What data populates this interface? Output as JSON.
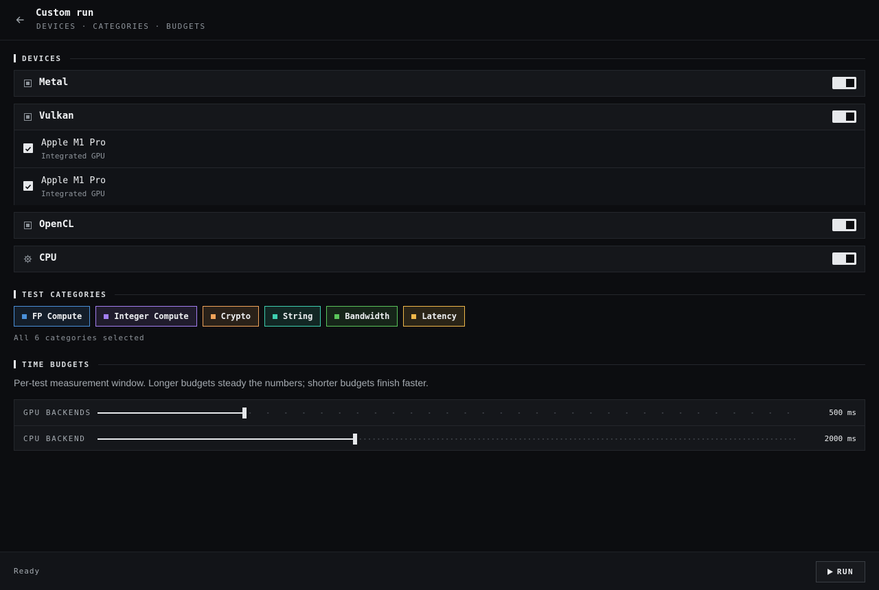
{
  "header": {
    "title": "Custom run",
    "subtitle": "DEVICES · CATEGORIES · BUDGETS"
  },
  "sections": {
    "devices": "DEVICES",
    "categories": "TEST CATEGORIES",
    "budgets": "TIME BUDGETS"
  },
  "devices": [
    {
      "name": "Metal",
      "icon": "chip-icon",
      "enabled": true
    },
    {
      "name": "Vulkan",
      "icon": "chip-icon",
      "enabled": true,
      "items": [
        {
          "name": "Apple M1 Pro",
          "type": "Integrated GPU",
          "checked": true
        },
        {
          "name": "Apple M1 Pro",
          "type": "Integrated GPU",
          "checked": true
        }
      ]
    },
    {
      "name": "OpenCL",
      "icon": "chip-icon",
      "enabled": true
    },
    {
      "name": "CPU",
      "icon": "gear-icon",
      "enabled": true
    }
  ],
  "categories": [
    {
      "label": "FP Compute",
      "color": "#4a90d9"
    },
    {
      "label": "Integer Compute",
      "color": "#a27ef0"
    },
    {
      "label": "Crypto",
      "color": "#f0a35a"
    },
    {
      "label": "String",
      "color": "#3ecfb0"
    },
    {
      "label": "Bandwidth",
      "color": "#5ac45a"
    },
    {
      "label": "Latency",
      "color": "#f0b84a"
    }
  ],
  "categories_note": "All 6 categories selected",
  "budgets_desc": "Per-test measurement window. Longer budgets steady the numbers; shorter budgets finish faster.",
  "budgets": [
    {
      "label": "GPU BACKENDS",
      "value": "500 ms",
      "fraction": 0.21,
      "tick_count": 39
    },
    {
      "label": "CPU BACKEND",
      "value": "2000 ms",
      "fraction": 0.368,
      "tick_count": 153
    }
  ],
  "footer": {
    "status": "Ready",
    "run_label": "RUN"
  }
}
